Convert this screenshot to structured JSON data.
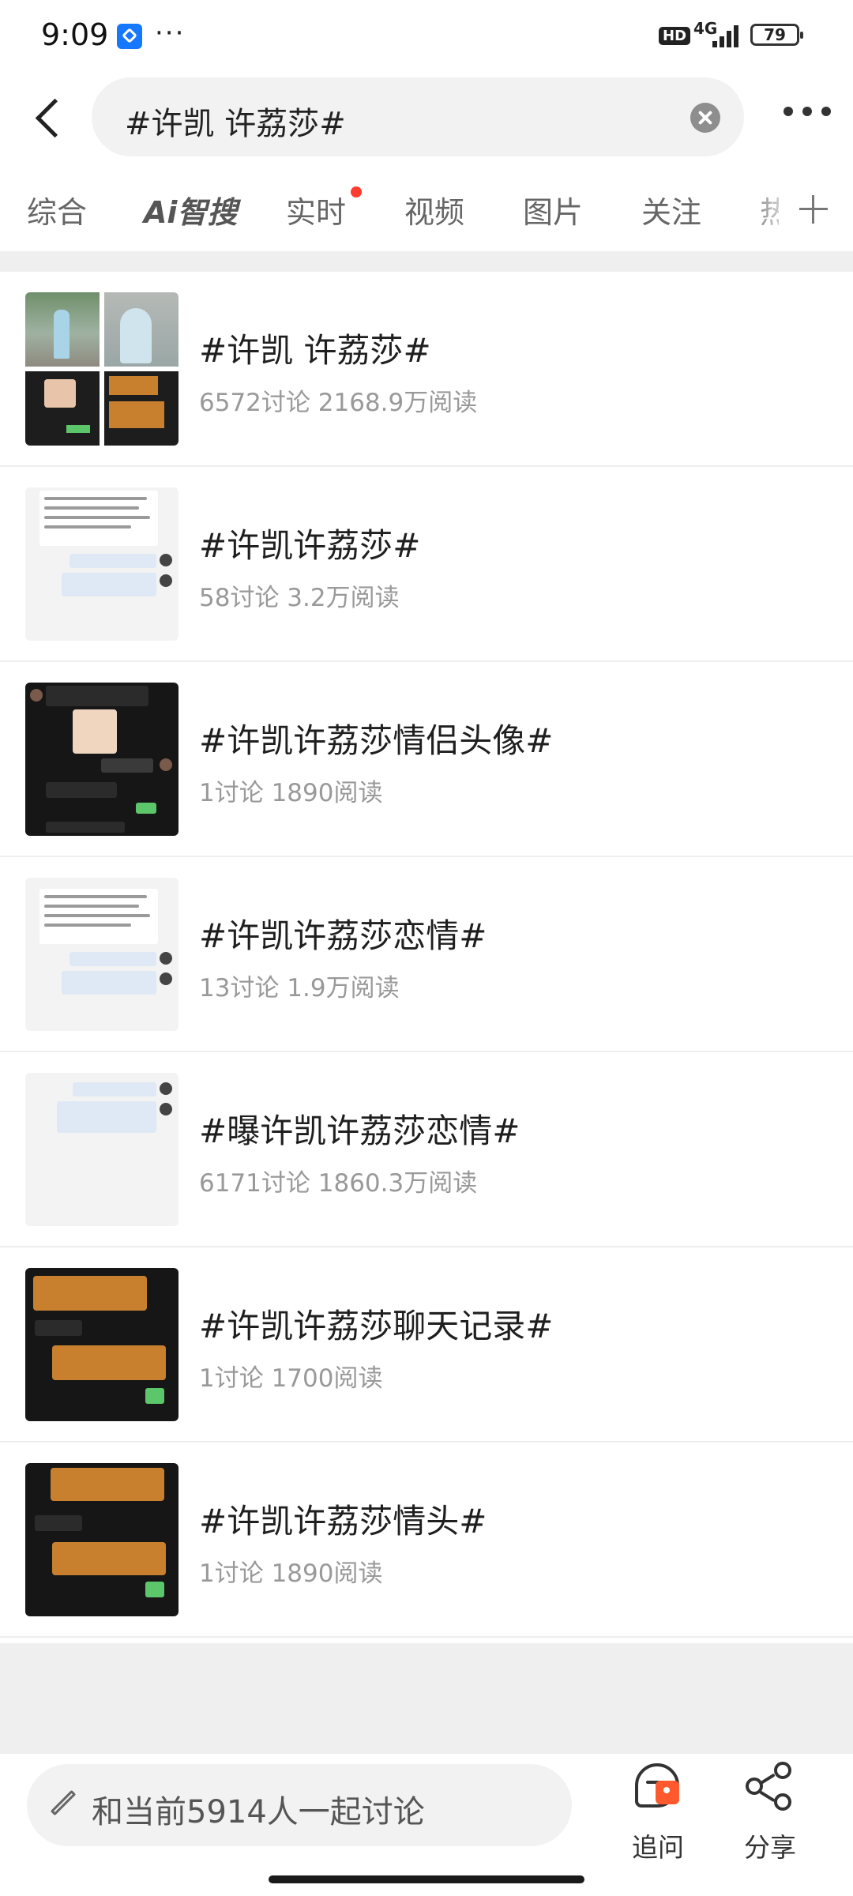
{
  "status_bar": {
    "time": "9:09",
    "network": "4G",
    "hd_label": "HD",
    "battery": "79",
    "app_indicator_icon": "ai-app-icon",
    "more_notifications": "···"
  },
  "search": {
    "query": "#许凯 许荔莎#",
    "clear_icon": "clear-icon",
    "back_icon": "back-arrow-icon",
    "more_icon": "more-icon"
  },
  "tabs": [
    {
      "label": "综合",
      "active": false
    },
    {
      "label": "Ai智搜",
      "active": false
    },
    {
      "label": "实时",
      "active": false,
      "has_dot": true
    },
    {
      "label": "视频",
      "active": false
    },
    {
      "label": "图片",
      "active": false
    },
    {
      "label": "关注",
      "active": false
    },
    {
      "label": "热",
      "active": false
    }
  ],
  "results": [
    {
      "title": "#许凯 许荔莎#",
      "meta": "6572讨论 2168.9万阅读",
      "thumb": "photo-collage"
    },
    {
      "title": "#许凯许荔莎#",
      "meta": "58讨论 3.2万阅读",
      "thumb": "chat-light"
    },
    {
      "title": "#许凯许荔莎情侣头像#",
      "meta": "1讨论 1890阅读",
      "thumb": "chat-dark"
    },
    {
      "title": "#许凯许荔莎恋情#",
      "meta": "13讨论 1.9万阅读",
      "thumb": "chat-light"
    },
    {
      "title": "#曝许凯许荔莎恋情#",
      "meta": "6171讨论 1860.3万阅读",
      "thumb": "chat-light-short"
    },
    {
      "title": "#许凯许荔莎聊天记录#",
      "meta": "1讨论 1700阅读",
      "thumb": "transfer-dark"
    },
    {
      "title": "#许凯许荔莎情头#",
      "meta": "1讨论 1890阅读",
      "thumb": "transfer-dark"
    }
  ],
  "bottom_bar": {
    "compose_placeholder": "和当前5914人一起讨论",
    "ask_label": "追问",
    "share_label": "分享"
  },
  "colors": {
    "notification_dot": "#ff3b30",
    "page_gray": "#efefef",
    "meta_text": "#999999"
  }
}
